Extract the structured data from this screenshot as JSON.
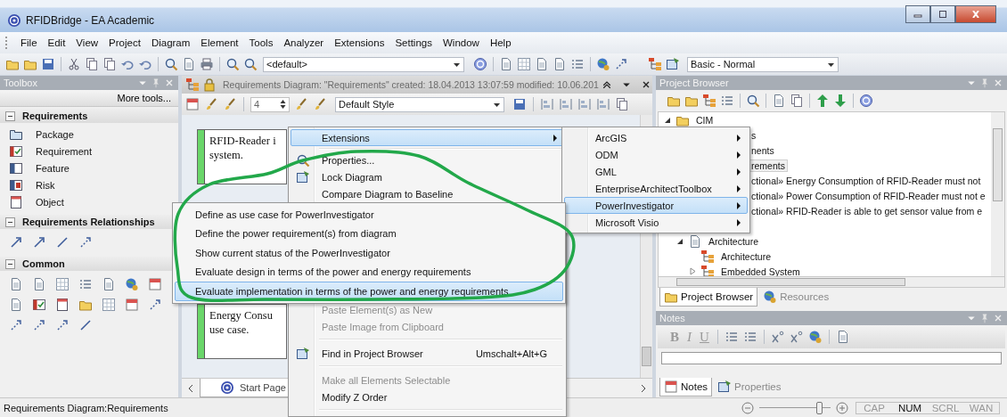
{
  "window": {
    "title": "RFIDBridge - EA Academic"
  },
  "menu_bar": [
    "File",
    "Edit",
    "View",
    "Project",
    "Diagram",
    "Element",
    "Tools",
    "Analyzer",
    "Extensions",
    "Settings",
    "Window",
    "Help"
  ],
  "toolbar": {
    "diagram_combo": "<default>",
    "workspace_combo": "Basic - Normal"
  },
  "toolbox": {
    "title": "Toolbox",
    "more_tools": "More tools...",
    "sections": [
      {
        "title": "Requirements",
        "expanded": true,
        "items": [
          "Package",
          "Requirement",
          "Feature",
          "Risk",
          "Object"
        ]
      },
      {
        "title": "Requirements Relationships",
        "expanded": true
      },
      {
        "title": "Common",
        "expanded": true
      }
    ]
  },
  "diagram": {
    "title": "Requirements Diagram: \"Requirements\"   created: 18.04.2013 13:07:59  modified: 10.06.201",
    "font_size": "4",
    "style": "Default Style",
    "notes": [
      {
        "lines": [
          "RFID-Reader i",
          "system."
        ]
      },
      {
        "lines": [
          "Energy Consu",
          "use case."
        ]
      }
    ],
    "tabs": [
      {
        "label": "Start Page",
        "selected": true
      }
    ]
  },
  "project_browser": {
    "title": "Project Browser",
    "tree": [
      {
        "label": "CIM",
        "expanded": true,
        "selected": false,
        "children": [
          {
            "label": "s",
            "partly_hidden": true,
            "selected": false
          },
          {
            "label": "nents",
            "partly_hidden": true,
            "selected": false,
            "children": [
              {
                "label": "rements",
                "partly_hidden": true,
                "selected": true,
                "children": [
                  {
                    "label": "ctional» Energy Consumption of RFID-Reader must not",
                    "partly_hidden": true,
                    "selected": false
                  },
                  {
                    "label": "ctional» Power Consumption of RFID-Reader must not e",
                    "partly_hidden": true,
                    "selected": false
                  },
                  {
                    "label": "ctional» RFID-Reader is able to get sensor value from e",
                    "partly_hidden": true,
                    "selected": false
                  }
                ]
              }
            ]
          },
          {
            "label": "Architecture",
            "expanded": true,
            "selected": false,
            "children": [
              {
                "label": "Architecture",
                "selected": false
              },
              {
                "label": "Embedded System",
                "expanded": false,
                "selected": false
              }
            ]
          }
        ]
      }
    ],
    "tabs": [
      {
        "label": "Project Browser",
        "selected": true
      },
      {
        "label": "Resources",
        "selected": false
      }
    ]
  },
  "notes": {
    "title": "Notes",
    "format_buttons": [
      "B",
      "I",
      "U"
    ],
    "tabs": [
      {
        "label": "Notes",
        "selected": true
      },
      {
        "label": "Properties",
        "selected": false
      }
    ]
  },
  "status_bar": {
    "text": "Requirements Diagram:Requirements",
    "zoom": {
      "level": 0.85
    },
    "indicators": [
      {
        "label": "CAP",
        "on": false
      },
      {
        "label": "NUM",
        "on": true
      },
      {
        "label": "SCRL",
        "on": false
      },
      {
        "label": "WAN",
        "on": false
      }
    ]
  },
  "context_menu": {
    "items": [
      {
        "kind": "item",
        "label": "Extensions",
        "submenu": true,
        "icon": false,
        "disabled": false,
        "selected": true
      },
      {
        "kind": "separator"
      },
      {
        "kind": "item",
        "label": "Properties...",
        "submenu": false,
        "icon": true,
        "disabled": false,
        "selected": false
      },
      {
        "kind": "item",
        "label": "Lock Diagram",
        "submenu": false,
        "icon": true,
        "disabled": false,
        "selected": false
      },
      {
        "kind": "item",
        "label": "Compare Diagram to Baseline",
        "submenu": false,
        "icon": false,
        "disabled": false,
        "selected": false
      },
      {
        "kind": "gap"
      },
      {
        "kind": "item",
        "label": "Paste Element(s) as New",
        "submenu": false,
        "icon": false,
        "disabled": true,
        "selected": false
      },
      {
        "kind": "item",
        "label": "Paste Image from Clipboard",
        "submenu": false,
        "icon": false,
        "disabled": true,
        "selected": false
      },
      {
        "kind": "separator"
      },
      {
        "kind": "item",
        "label": "Find in Project Browser",
        "shortcut": "Umschalt+Alt+G",
        "submenu": false,
        "icon": true,
        "disabled": false,
        "selected": false
      },
      {
        "kind": "separator"
      },
      {
        "kind": "item",
        "label": "Make all Elements Selectable",
        "submenu": false,
        "icon": false,
        "disabled": true,
        "selected": false
      },
      {
        "kind": "item",
        "label": "Modify Z Order",
        "submenu": false,
        "icon": false,
        "disabled": false,
        "selected": false
      },
      {
        "kind": "separator"
      }
    ]
  },
  "extensions_submenu": {
    "items": [
      {
        "kind": "item",
        "label": "ArcGIS",
        "submenu": true,
        "selected": false
      },
      {
        "kind": "item",
        "label": "ODM",
        "submenu": true,
        "selected": false
      },
      {
        "kind": "item",
        "label": "GML",
        "submenu": true,
        "selected": false
      },
      {
        "kind": "item",
        "label": "EnterpriseArchitectToolbox",
        "submenu": true,
        "selected": false
      },
      {
        "kind": "item",
        "label": "PowerInvestigator",
        "submenu": true,
        "selected": true
      },
      {
        "kind": "item",
        "label": "Microsoft Visio",
        "submenu": true,
        "selected": false
      }
    ]
  },
  "power_investigator_submenu": {
    "items": [
      {
        "kind": "item",
        "label": "Define as use case for PowerInvestigator",
        "selected": false
      },
      {
        "kind": "item",
        "label": "Define the power requirement(s) from diagram",
        "selected": false
      },
      {
        "kind": "item",
        "label": "Show current status of the PowerInvestigator",
        "selected": false
      },
      {
        "kind": "item",
        "label": "Evaluate design in terms of the power and energy requirements",
        "selected": false
      },
      {
        "kind": "item",
        "label": "Evaluate implementation in terms of the power and energy requirements",
        "selected": true
      }
    ]
  }
}
